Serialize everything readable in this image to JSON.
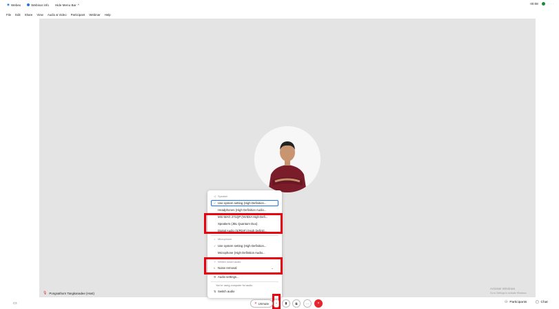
{
  "titlebar": {
    "app_name": "Webex",
    "webinar_info": "Webinar info",
    "hide_menu_bar": "Hide Menu Bar",
    "hide_menu_chevron": "^",
    "clock": "00:08"
  },
  "menubar": {
    "items": [
      "File",
      "Edit",
      "Share",
      "View",
      "Audio & Video",
      "Participant",
      "Webinar",
      "Help"
    ]
  },
  "participant": {
    "name": "Pongsathorn Tangkanadee (Host)"
  },
  "audio_menu": {
    "speaker_section": "Speaker",
    "speaker_options": [
      "Use system setting (High Definition...",
      "Headphones (High Definition Audio...",
      "MSI MAG 271QP (NVIDIA High Defi...",
      "Speakers (JBL Quantum Duo)",
      "Digital Audio (S/PDIF) (High Definiti..."
    ],
    "microphone_section": "Microphone",
    "microphone_options": [
      "Use system setting (High Definition...",
      "Microphone (High Definition Audio..."
    ],
    "smart_audio_section": "Webex smart audio",
    "noise_removal": "Noise removal",
    "audio_settings": "Audio settings...",
    "using_computer_note": "You're using computer for audio",
    "switch_audio": "Switch audio"
  },
  "controls": {
    "unmute": "Unmute",
    "more": "···",
    "leave": "×",
    "participants": "Participants",
    "chat": "Chat"
  },
  "watermark": {
    "title": "Activate Windows",
    "subtitle": "Go to Settings to activate Windows."
  },
  "colors": {
    "accent": "#1a73e8",
    "highlight": "#e8000f",
    "leave": "#e3262f",
    "stage": "#e4e4e4"
  }
}
